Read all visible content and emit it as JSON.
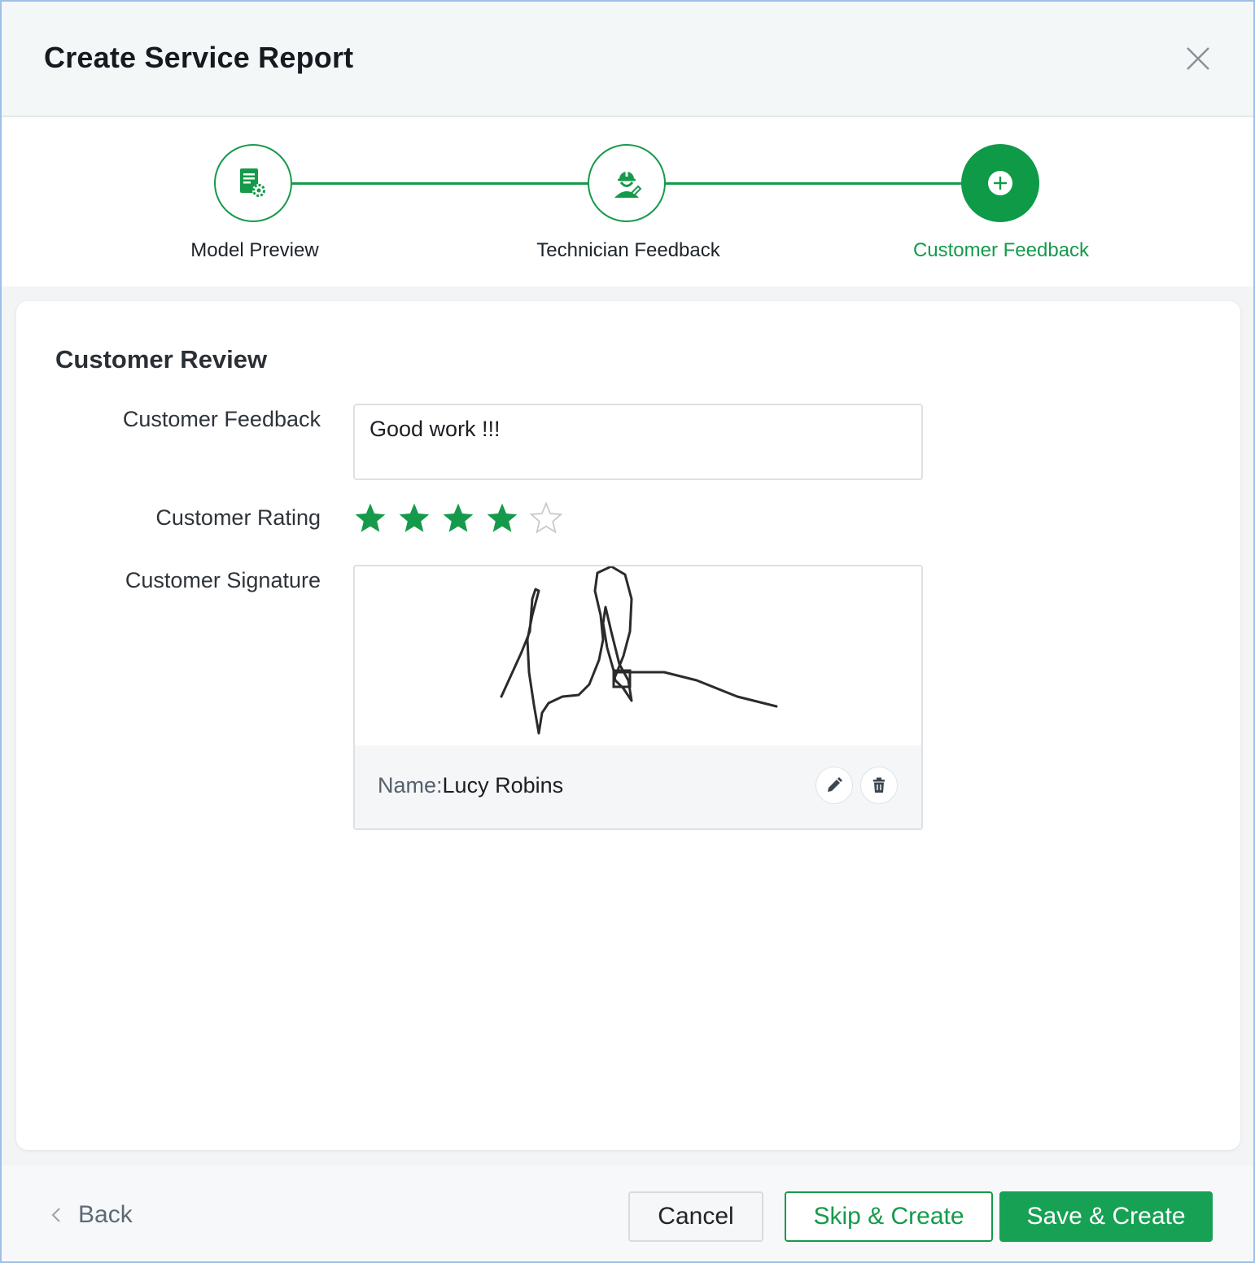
{
  "dialog": {
    "title": "Create Service Report"
  },
  "stepper": {
    "steps": [
      {
        "label": "Model Preview",
        "icon": "report-settings-icon",
        "state": "completed"
      },
      {
        "label": "Technician Feedback",
        "icon": "technician-icon",
        "state": "completed"
      },
      {
        "label": "Customer Feedback",
        "icon": "plus-icon",
        "state": "active"
      }
    ]
  },
  "review": {
    "section_title": "Customer Review",
    "feedback_label": "Customer Feedback",
    "feedback_value": "Good work !!!",
    "rating_label": "Customer Rating",
    "rating": 4,
    "rating_max": 5,
    "signature_label": "Customer Signature",
    "signature_name_prefix": "Name:",
    "signature_name": "Lucy Robins"
  },
  "footer": {
    "back_label": "Back",
    "cancel_label": "Cancel",
    "skip_label": "Skip & Create",
    "save_label": "Save & Create"
  },
  "colors": {
    "accent": "#159a4b",
    "accent_dark": "#0f9a48",
    "star_empty": "#c9c9c9"
  }
}
